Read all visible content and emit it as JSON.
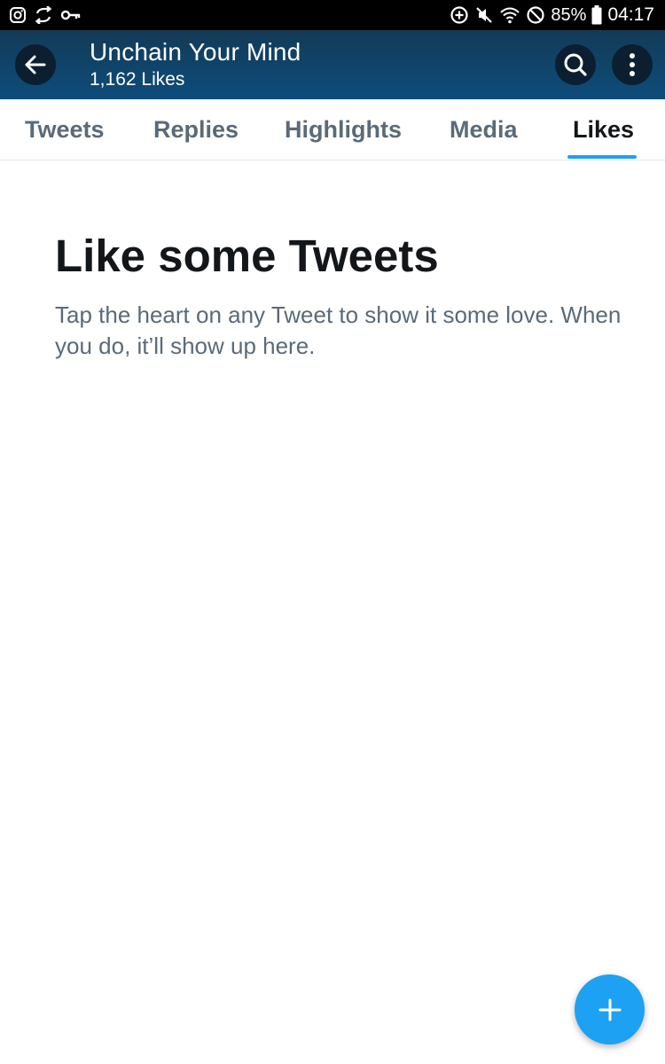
{
  "status_bar": {
    "battery": "85%",
    "time": "04:17",
    "icons": [
      "instagram-icon",
      "sync-icon",
      "key-icon",
      "data-saver-icon",
      "mute-icon",
      "wifi-icon",
      "do-not-disturb-icon",
      "battery-icon"
    ]
  },
  "header": {
    "profile_name": "Unchain Your Mind",
    "likes_count": "1,162 Likes",
    "icons": [
      "back-arrow-icon",
      "search-icon",
      "more-vertical-icon"
    ]
  },
  "tabs": [
    {
      "label": "Tweets",
      "active": false
    },
    {
      "label": "Replies",
      "active": false
    },
    {
      "label": "Highlights",
      "active": false
    },
    {
      "label": "Media",
      "active": false
    },
    {
      "label": "Likes",
      "active": true
    }
  ],
  "empty_state": {
    "title": "Like some Tweets",
    "message": "Tap the heart on any Tweet to show it some love. When you do, it’ll show up here."
  },
  "fab": {
    "icon": "plus-icon"
  },
  "colors": {
    "accent": "#1da1f2",
    "header_bg": "#133a57",
    "tab_inactive": "#5b6a78",
    "text_primary": "#14171a"
  }
}
